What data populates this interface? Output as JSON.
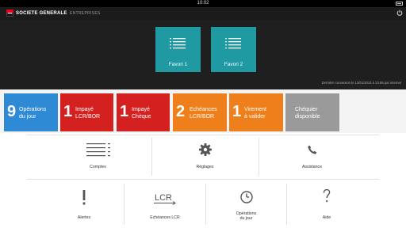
{
  "status_bar": {
    "time": "10:02"
  },
  "header": {
    "brand": "SOCIETE GENERALE",
    "separator": "/",
    "section": "ENTREPRISES"
  },
  "favorites": [
    {
      "label": "Favori 1"
    },
    {
      "label": "Favori 2"
    }
  ],
  "last_connection": "Dernière connexion le 13/01/2013 à 13:56 par internet",
  "tiles": [
    {
      "count": "9",
      "line1": "Opérations",
      "line2": "du jour",
      "color": "#2f8ad6"
    },
    {
      "count": "1",
      "line1": "Impayé",
      "line2": "LCR/BOR",
      "color": "#d4201e"
    },
    {
      "count": "1",
      "line1": "Impayé",
      "line2": "Chèque",
      "color": "#d4201e"
    },
    {
      "count": "2",
      "line1": "Echéances",
      "line2": "LCR/BOR",
      "color": "#ef7f1a"
    },
    {
      "count": "1",
      "line1": "Virement",
      "line2": "à valider",
      "color": "#ef7f1a"
    },
    {
      "count": "",
      "line1": "Chéquier",
      "line2": "disponible",
      "color": "#9a9a9a"
    }
  ],
  "menu_row1": [
    {
      "label": "Comptes",
      "icon": "list-icon"
    },
    {
      "label": "Réglages",
      "icon": "gear-icon"
    },
    {
      "label": "Assistance",
      "icon": "phone-icon"
    }
  ],
  "menu_row2": [
    {
      "label": "Alertes",
      "icon": "exclamation-icon"
    },
    {
      "label": "Echéances LCR",
      "icon": "lcr-icon",
      "icon_text": "LCR"
    },
    {
      "label_line1": "Opérations",
      "label_line2": "du jour",
      "icon": "clock-icon"
    },
    {
      "label": "Aide",
      "icon": "question-icon"
    }
  ]
}
